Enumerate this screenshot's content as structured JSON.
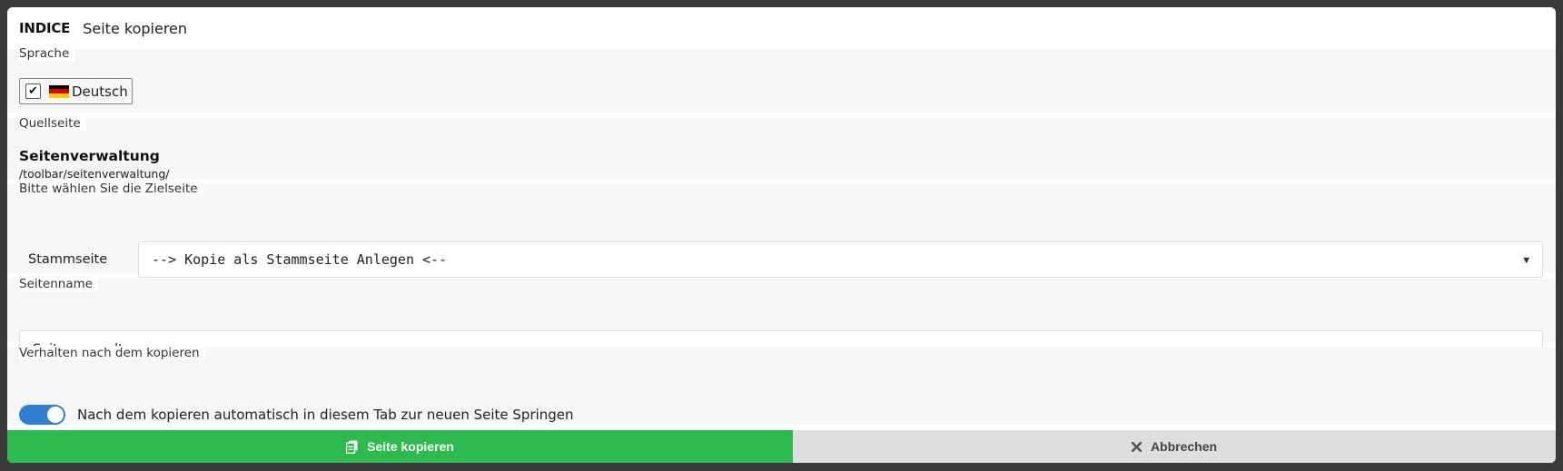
{
  "header": {
    "brand": "INDICE",
    "title": "Seite kopieren"
  },
  "language": {
    "label": "Sprache",
    "option": {
      "checked": true,
      "flag_icon": "flag-de-icon",
      "label": "Deutsch"
    }
  },
  "source": {
    "label": "Quellseite",
    "title": "Seitenverwaltung",
    "path": "/toolbar/seitenverwaltung/"
  },
  "target": {
    "label": "Bitte wählen Sie die Zielseite",
    "field_label": "Stammseite",
    "selected": "--> Kopie als Stammseite Anlegen <--"
  },
  "page_name": {
    "label": "Seitenname",
    "value": "Seitenverwaltung"
  },
  "behavior": {
    "label": "Verhalten nach dem kopieren",
    "toggle_on": true,
    "toggle_label": "Nach dem kopieren automatisch in diesem Tab zur neuen Seite Springen"
  },
  "actions": {
    "copy": {
      "label": "Seite kopieren",
      "icon": "copy-icon"
    },
    "cancel": {
      "label": "Abbrechen",
      "icon": "close-icon"
    }
  },
  "colors": {
    "primary_button": "#2dba4e",
    "secondary_button": "#dedede",
    "toggle_active": "#2e7fd0"
  }
}
